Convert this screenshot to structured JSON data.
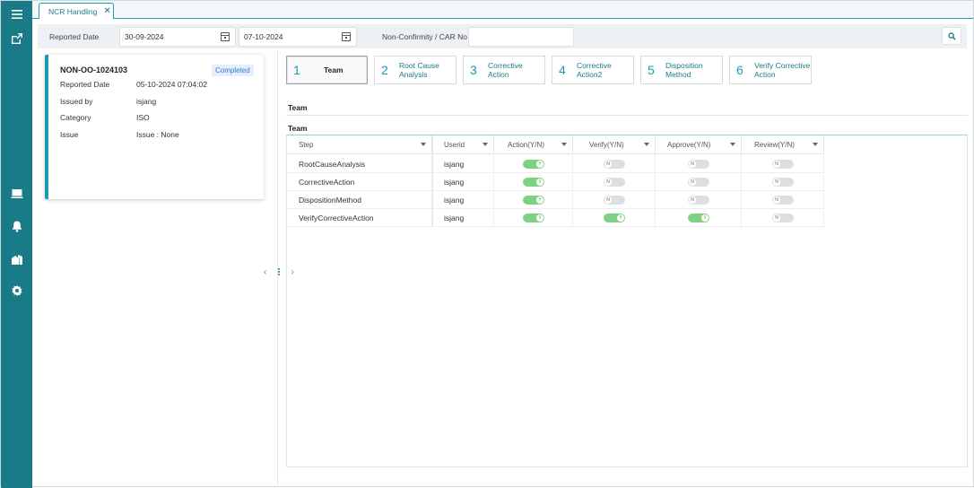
{
  "tab": {
    "label": "NCR Handling",
    "close_icon": "close-icon"
  },
  "filters": {
    "reported_date_label": "Reported Date",
    "date_from": "30-09-2024",
    "date_to": "07-10-2024",
    "car_label": "Non-Confirmity / CAR No",
    "car_value": ""
  },
  "card": {
    "id": "NON-OO-1024103",
    "status": "Completed",
    "rows": [
      {
        "label": "Reported Date",
        "value": "05-10-2024 07:04:02"
      },
      {
        "label": "Issued by",
        "value": "isjang"
      },
      {
        "label": "Category",
        "value": "ISO"
      },
      {
        "label": "Issue",
        "value": "Issue : None"
      }
    ]
  },
  "steps": [
    {
      "num": "1",
      "line1": "Team",
      "line2": "",
      "active": true
    },
    {
      "num": "2",
      "line1": "Root Cause",
      "line2": "Analysis",
      "active": false
    },
    {
      "num": "3",
      "line1": "Corrective",
      "line2": "Action",
      "active": false
    },
    {
      "num": "4",
      "line1": "Corrective",
      "line2": "Action2",
      "active": false
    },
    {
      "num": "5",
      "line1": "Disposition",
      "line2": "Method",
      "active": false
    },
    {
      "num": "6",
      "line1": "Verify Corrective",
      "line2": "Action",
      "active": false
    }
  ],
  "section_title": "Team",
  "grid_title": "Team",
  "grid": {
    "columns": [
      "Step",
      "Userid",
      "Action(Y/N)",
      "Verify(Y/N)",
      "Approve(Y/N)",
      "Review(Y/N)"
    ],
    "rows": [
      {
        "step": "RootCauseAnalysis",
        "userid": "isjang",
        "action": true,
        "verify": false,
        "approve": false,
        "review": false
      },
      {
        "step": "CorrectiveAction",
        "userid": "isjang",
        "action": true,
        "verify": false,
        "approve": false,
        "review": false
      },
      {
        "step": "DispositionMethod",
        "userid": "isjang",
        "action": true,
        "verify": false,
        "approve": false,
        "review": false
      },
      {
        "step": "VerifyCorrectiveAction",
        "userid": "isjang",
        "action": true,
        "verify": true,
        "approve": true,
        "review": false
      }
    ],
    "toggle_on": "Y",
    "toggle_off": "N"
  },
  "colors": {
    "sidebar": "#1a7b88",
    "accent": "#1a9bb0",
    "toggle_on": "#7fd283",
    "toggle_off": "#dcdfe2"
  },
  "sidebar_icons": [
    "menu-icon",
    "export-icon",
    "monitor-icon",
    "bell-icon",
    "buildings-icon",
    "settings-icon"
  ]
}
